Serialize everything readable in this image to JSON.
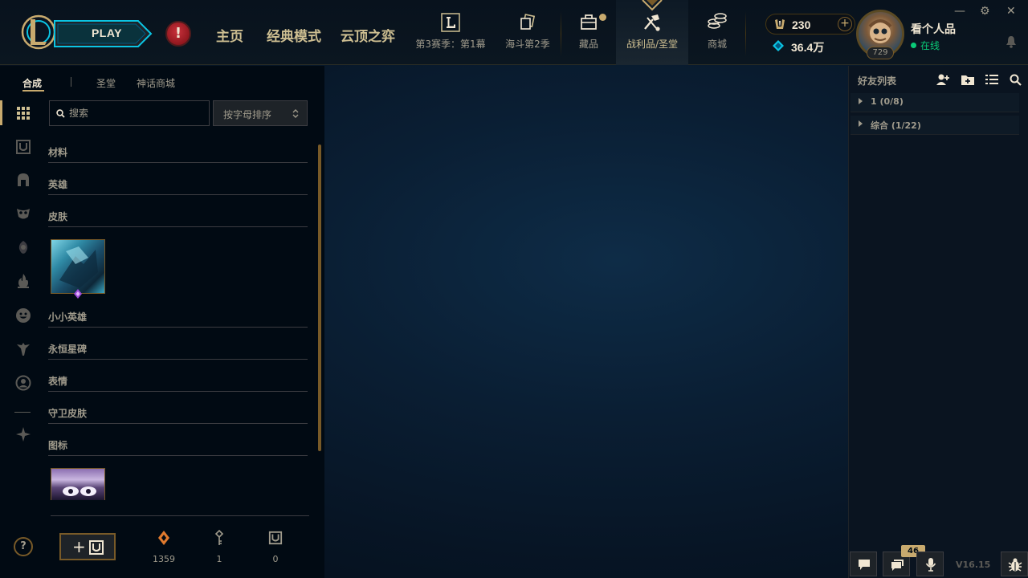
{
  "topbar": {
    "play_label": "PLAY",
    "alert_symbol": "!",
    "nav_main": [
      "主页",
      "经典模式",
      "云顶之弈"
    ],
    "nav_icons": [
      {
        "label": "第3赛季：第1幕",
        "icon": "season-icon",
        "glyph": "L"
      },
      {
        "label": "海斗第2季",
        "icon": "event-pass-icon"
      },
      {
        "label": "藏品",
        "icon": "collection-icon"
      },
      {
        "label": "战利品/圣堂",
        "icon": "loot-icon"
      },
      {
        "label": "商城",
        "icon": "store-icon"
      }
    ],
    "active_nav": "战利品/圣堂",
    "collection_has_notification": true
  },
  "currency": {
    "rp": "230",
    "rp_plus": "+",
    "blue_essence": "36.4万"
  },
  "user": {
    "name": "看个人品",
    "status": "在线",
    "level": "729"
  },
  "window_controls": {
    "minimize": "—",
    "settings": "⚙",
    "close": "✕"
  },
  "loot": {
    "tabs": [
      "合成",
      "圣堂",
      "神话商城"
    ],
    "active_tab": "合成",
    "search_placeholder": "搜索",
    "sort_label": "按字母排序",
    "categories": [
      "材料",
      "英雄",
      "皮肤",
      "小小英雄",
      "永恒星碑",
      "表情",
      "守卫皮肤",
      "图标"
    ],
    "rail_icons": [
      "grid-icon",
      "chest-icon",
      "helmet-icon",
      "mask-icon",
      "companion-icon",
      "flame-icon",
      "emote-icon",
      "statue-icon",
      "profile-icon",
      "ward-icon"
    ],
    "counters": [
      {
        "icon": "orange-essence-icon",
        "value": "1359"
      },
      {
        "icon": "key-icon",
        "value": "1"
      },
      {
        "icon": "chest-icon",
        "value": "0"
      }
    ],
    "help_symbol": "?",
    "craft_label": "+"
  },
  "friends": {
    "title": "好友列表",
    "groups": [
      "1 (0/8)",
      "综合 (1/22)"
    ],
    "notification_count": "46",
    "version": "V16.15"
  },
  "colors": {
    "gold": "#c8aa6e",
    "gold_dark": "#785a28",
    "text": "#a09b8c",
    "text_light": "#f0e6d2",
    "online": "#0acb78",
    "alert": "#c8313b",
    "essence": "#e07a2e"
  }
}
